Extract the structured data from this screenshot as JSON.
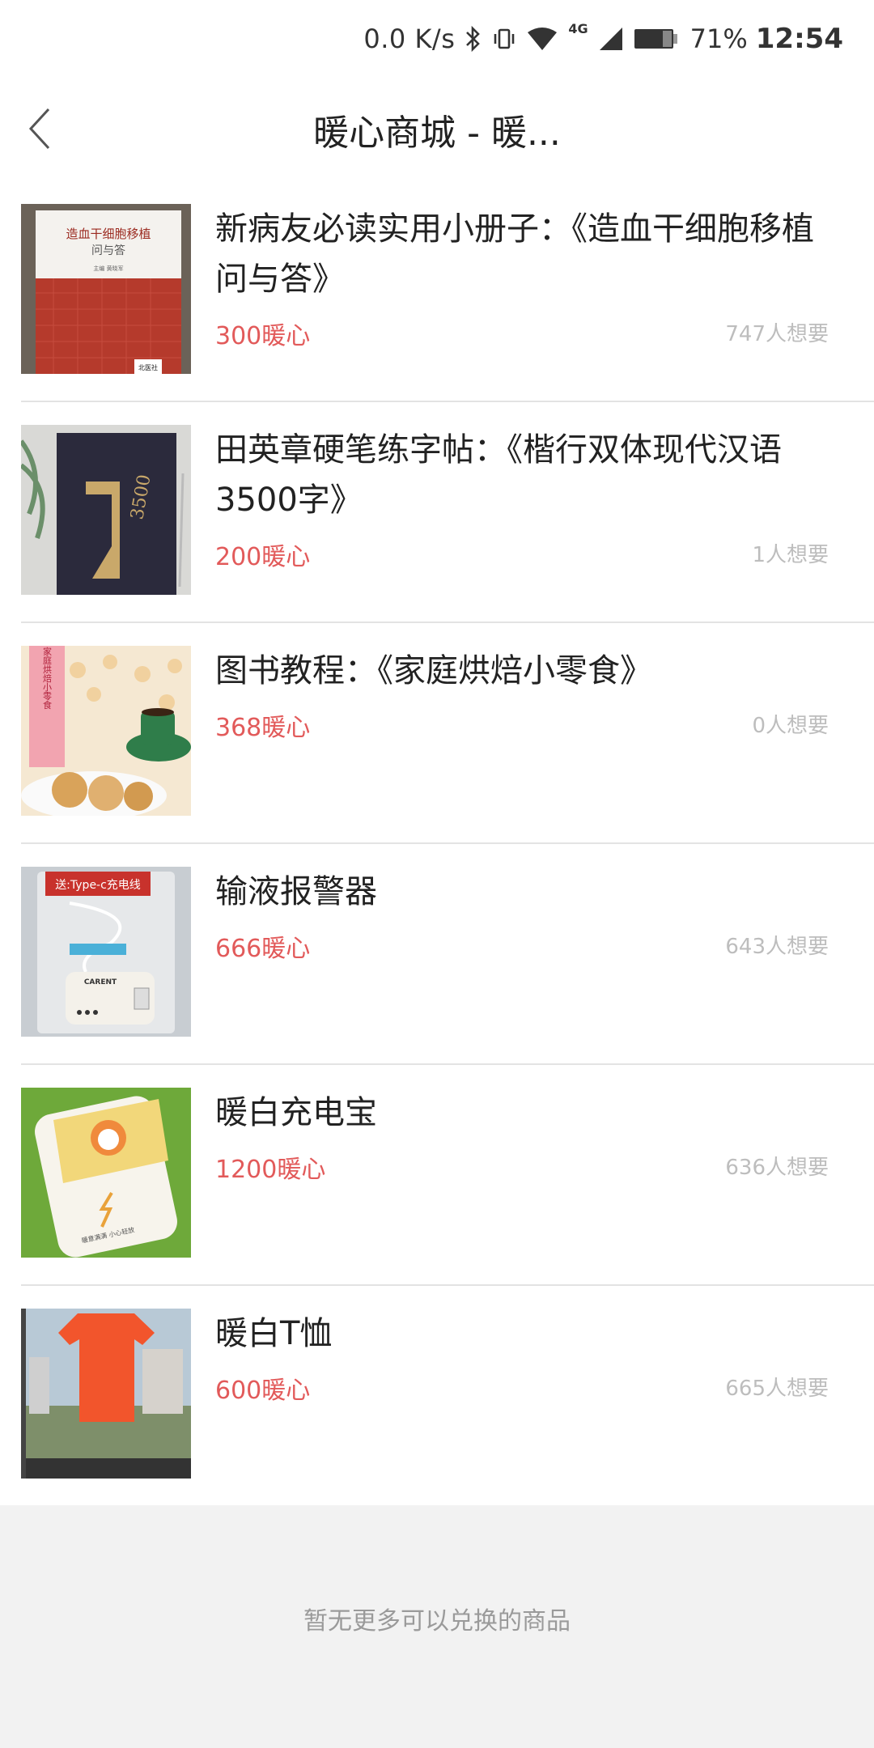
{
  "status_bar": {
    "net_speed": "0.0 K/s",
    "battery_pct": "71%",
    "time": "12:54",
    "icons": [
      "bluetooth-icon",
      "vibrate-icon",
      "wifi-icon",
      "4g-icon",
      "signal-icon",
      "battery-icon"
    ],
    "lte_label": "4G"
  },
  "header": {
    "title": "暖心商城 - 暖...",
    "back_icon": "chevron-left-icon"
  },
  "items": [
    {
      "title": "新病友必读实用小册子：《造血干细胞移植问与答》",
      "price": "300暖心",
      "wants": "747人想要",
      "thumb": {
        "book_title_line1": "造血干细胞移植",
        "book_title_line2": "问与答",
        "editor": "主编 黄晓军",
        "publisher": "北医社"
      }
    },
    {
      "title": "田英章硬笔练字帖：《楷行双体现代汉语3500字》",
      "price": "200暖心",
      "wants": "1人想要",
      "thumb": {
        "cover_text": "3500"
      }
    },
    {
      "title": "图书教程：《家庭烘焙小零食》",
      "price": "368暖心",
      "wants": "0人想要",
      "thumb": {
        "cover_text": "家庭烘焙小零食"
      }
    },
    {
      "title": "输液报警器",
      "price": "666暖心",
      "wants": "643人想要",
      "thumb": {
        "banner": "送:Type-c充电线",
        "brand": "CARENT"
      }
    },
    {
      "title": "暖白充电宝",
      "price": "1200暖心",
      "wants": "636人想要",
      "thumb": {
        "slogan": "暖意满满 小心轻放"
      }
    },
    {
      "title": "暖白T恤",
      "price": "600暖心",
      "wants": "665人想要",
      "thumb": {}
    }
  ],
  "footer": {
    "text": "暂无更多可以兑换的商品"
  },
  "colors": {
    "price": "#e25a5a",
    "wants": "#bdbdbd",
    "footer_bg": "#f2f2f2"
  }
}
